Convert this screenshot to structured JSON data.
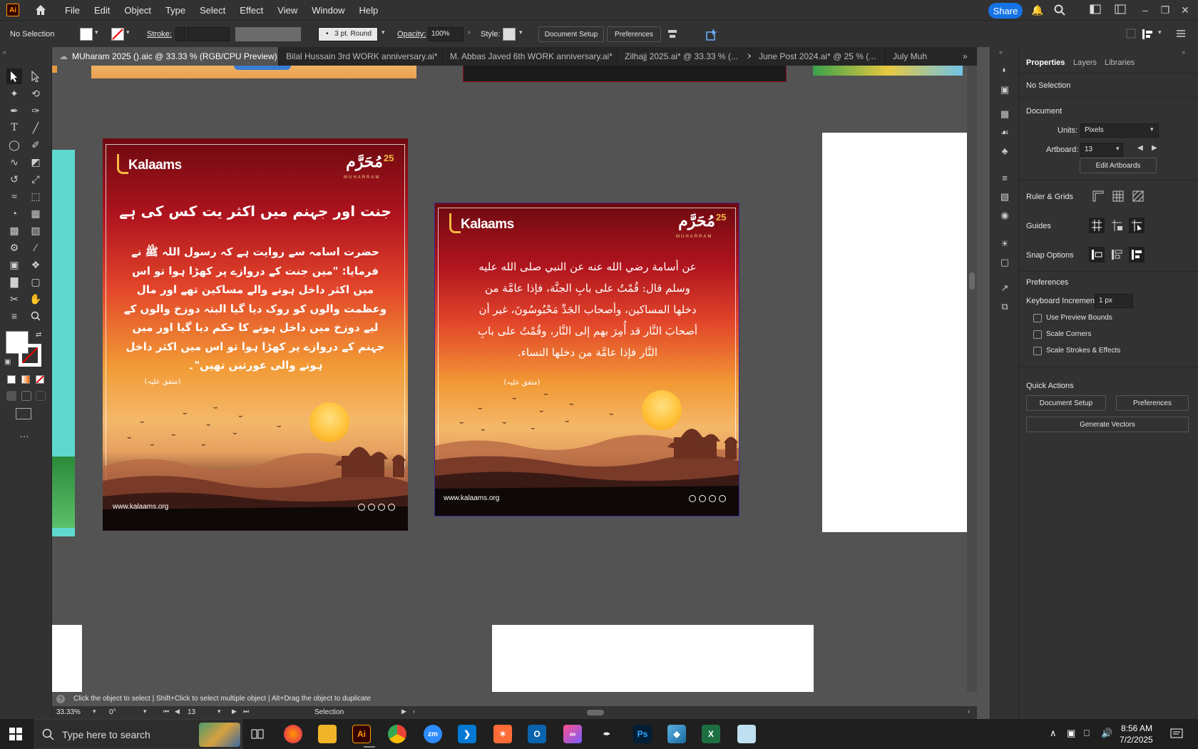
{
  "app": {
    "name": "Adobe Illustrator",
    "logo": "Ai"
  },
  "menu": [
    "File",
    "Edit",
    "Object",
    "Type",
    "Select",
    "Effect",
    "View",
    "Window",
    "Help"
  ],
  "share_label": "Share",
  "control": {
    "selection": "No Selection",
    "stroke_label": "Stroke:",
    "brush": "3 pt. Round",
    "opacity_label": "Opacity:",
    "opacity_value": "100%",
    "style_label": "Style:",
    "doc_setup": "Document Setup",
    "preferences": "Preferences"
  },
  "tabs": [
    {
      "label": "MUharam 2025 ().aic @ 33.33 % (RGB/CPU Preview)",
      "active": true
    },
    {
      "label": "Bilal Hussain  3rd  WORK anniversary.ai*",
      "active": false
    },
    {
      "label": "M. Abbas Javed  6th  WORK anniversary.ai*",
      "active": false
    },
    {
      "label": "Zilhajj 2025.ai* @ 33.33 % (...",
      "active": false
    },
    {
      "label": "June Post 2024.ai* @ 25 % (...",
      "active": false
    },
    {
      "label": "July Muh",
      "active": false
    }
  ],
  "properties": {
    "tabs": [
      "Properties",
      "Layers",
      "Libraries"
    ],
    "no_selection": "No Selection",
    "document": "Document",
    "units_label": "Units:",
    "units_value": "Pixels",
    "artboard_label": "Artboard:",
    "artboard_value": "13",
    "edit_artboards": "Edit Artboards",
    "ruler_grids": "Ruler & Grids",
    "guides": "Guides",
    "snap_options": "Snap Options",
    "preferences": "Preferences",
    "keyboard_increment_label": "Keyboard Increment:",
    "keyboard_increment_value": "1 px",
    "use_preview_bounds": "Use Preview Bounds",
    "scale_corners": "Scale Corners",
    "scale_strokes": "Scale Strokes & Effects",
    "quick_actions": "Quick Actions",
    "qa_doc_setup": "Document Setup",
    "qa_preferences": "Preferences",
    "generate_vectors": "Generate Vectors"
  },
  "hint": "Click the object to select  |  Shift+Click to select multiple object  |  Alt+Drag the object to duplicate",
  "status": {
    "zoom": "33.33%",
    "rotation": "0°",
    "artboard": "13",
    "tool": "Selection"
  },
  "poster_left": {
    "brand": "Kalaams",
    "muharram_ar": "مُحَرَّم",
    "year": "25",
    "muharram_en": "MUHARRAM",
    "title": "جنت اور جہنم میں اکثر یت کس کی ہے",
    "body": [
      "حضرت اسامہ سے روایت ہے کہ رسول اللہ ﷺ نے",
      "فرمایا: \"میں جنت کے دروازے پر کھڑا ہوا تو اس",
      "میں اکثر داخل ہونے والے مساکین تھے اور مال",
      "وعظمت والوں کو روک دیا گیا البتہ دوزخ والوں کے",
      "لیے دوزخ میں داخل ہونے کا حکم دیا گیا اور میں",
      "جہنم کے دروازے پر کھڑا ہوا تو اس میں اکثر داخل",
      "ہونے والی عورتیں تھیں\"۔"
    ],
    "ref": "(متفق علیہ)",
    "website": "www.kalaams.org"
  },
  "poster_right": {
    "brand": "Kalaams",
    "muharram_ar": "مُحَرَّم",
    "year": "25",
    "muharram_en": "MUHARRAM",
    "body": [
      "عن أسامة رضي الله عنه عن النبي صلى الله عليه",
      "وسلم قال: قُمْتُ على بابِ الجنَّة، فإذا عامَّة من",
      "دخلها المساكين، وأصحاب الجَدِّ مَحْبُوسُونَ، غير أن",
      "أصحابَ النَّار قد أُمِرَ بهم إلى النَّار، وقُمْتُ على بابِ",
      "النَّار فإذا عامَّة من دخلها النساء."
    ],
    "ref": "(متفق علیہ)",
    "website": "www.kalaams.org"
  },
  "taskbar": {
    "search_placeholder": "Type here to search",
    "time": "8:56 AM",
    "date": "7/2/2025",
    "apps": [
      "Firefox",
      "Explorer",
      "Ai",
      "Chrome",
      "zm",
      "VS Code",
      "Postman",
      "Outlook",
      "Creative Cloud",
      "Pen",
      "Ps",
      "App",
      "Excel",
      "Notes"
    ]
  }
}
